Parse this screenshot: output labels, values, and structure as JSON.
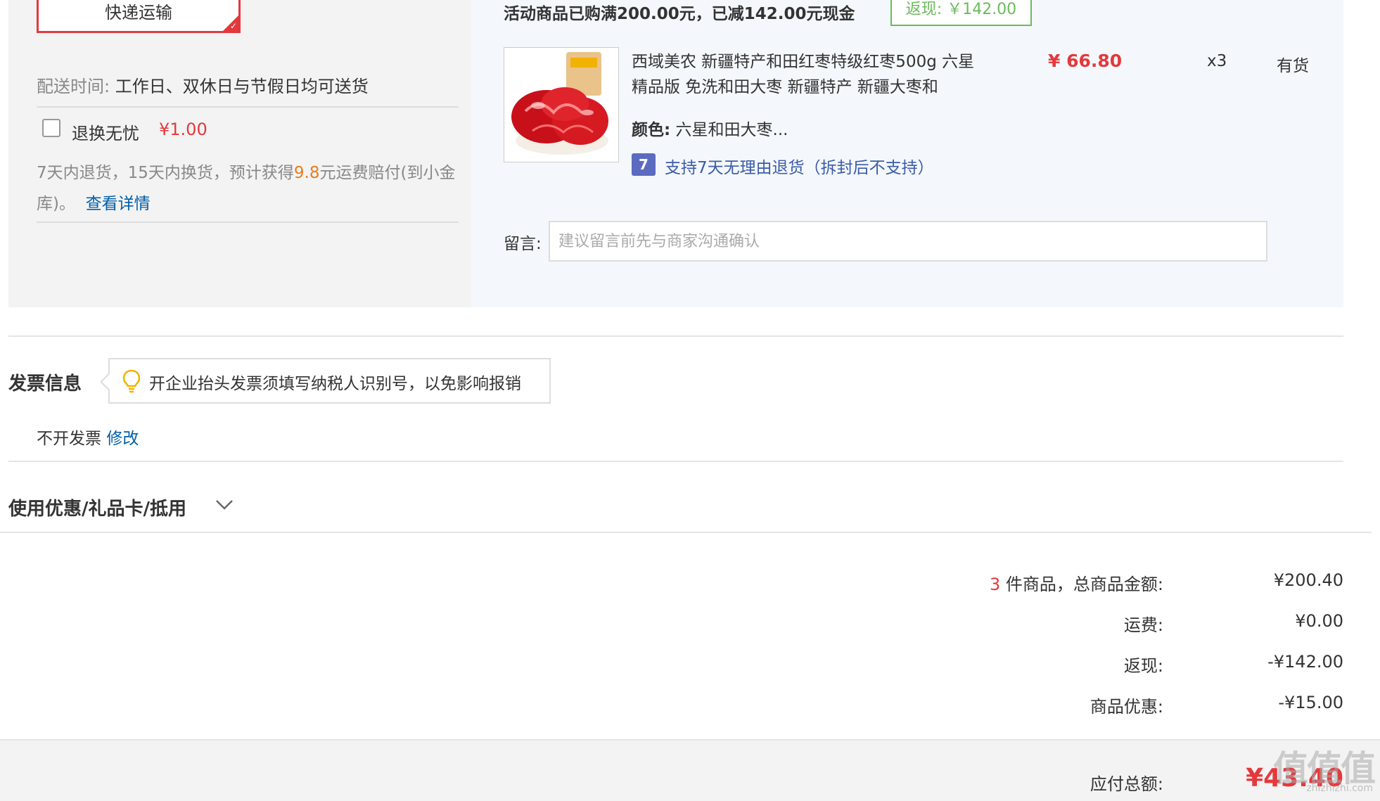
{
  "shipping": {
    "method_label": "快递运输",
    "delivery_time_label": "配送时间:",
    "delivery_time_value": "工作日、双休日与节假日均可送货",
    "return_worry_free_label": "退换无忧",
    "return_worry_free_price": "¥1.00",
    "return_desc_prefix": "7天内退货，15天内换货，预计获得",
    "return_desc_amount": "9.8",
    "return_desc_suffix": "元运费赔付(到小金库)。",
    "details_link": "查看详情"
  },
  "promo": {
    "text": "活动商品已购满200.00元，已减142.00元现金",
    "cashback_tag": "返现: ￥142.00"
  },
  "product": {
    "title": "西域美农 新疆特产和田红枣特级红枣500g 六星精品版 免洗和田大枣 新疆特产 新疆大枣和",
    "price": "¥ 66.80",
    "quantity": "x3",
    "stock": "有货",
    "color_label": "颜色:",
    "color_value": "六星和田大枣...",
    "return_policy_icon_text": "7",
    "return_policy": "支持7天无理由退货（拆封后不支持）"
  },
  "message": {
    "label": "留言:",
    "placeholder": "建议留言前先与商家沟通确认"
  },
  "invoice": {
    "title": "发票信息",
    "tip": "开企业抬头发票须填写纳税人识别号，以免影响报销",
    "value": "不开发票",
    "edit_link": "修改"
  },
  "coupon": {
    "title": "使用优惠/礼品卡/抵用"
  },
  "summary": {
    "item_count": "3",
    "item_total_label": " 件商品，总商品金额:",
    "item_total_value": "¥200.40",
    "shipping_label": "运费:",
    "shipping_value": "¥0.00",
    "cashback_label": "返现:",
    "cashback_value": "-¥142.00",
    "discount_label": "商品优惠:",
    "discount_value": "-¥15.00",
    "total_label": "应付总额:",
    "total_value": "¥43.40"
  },
  "watermark": {
    "main": "值值值",
    "sub": "zhizhizhi.com"
  },
  "colors": {
    "accent_red": "#e4393c",
    "link_blue": "#005ea7",
    "cashback_green": "#6bbb5a",
    "highlight_orange": "#e67e22"
  }
}
